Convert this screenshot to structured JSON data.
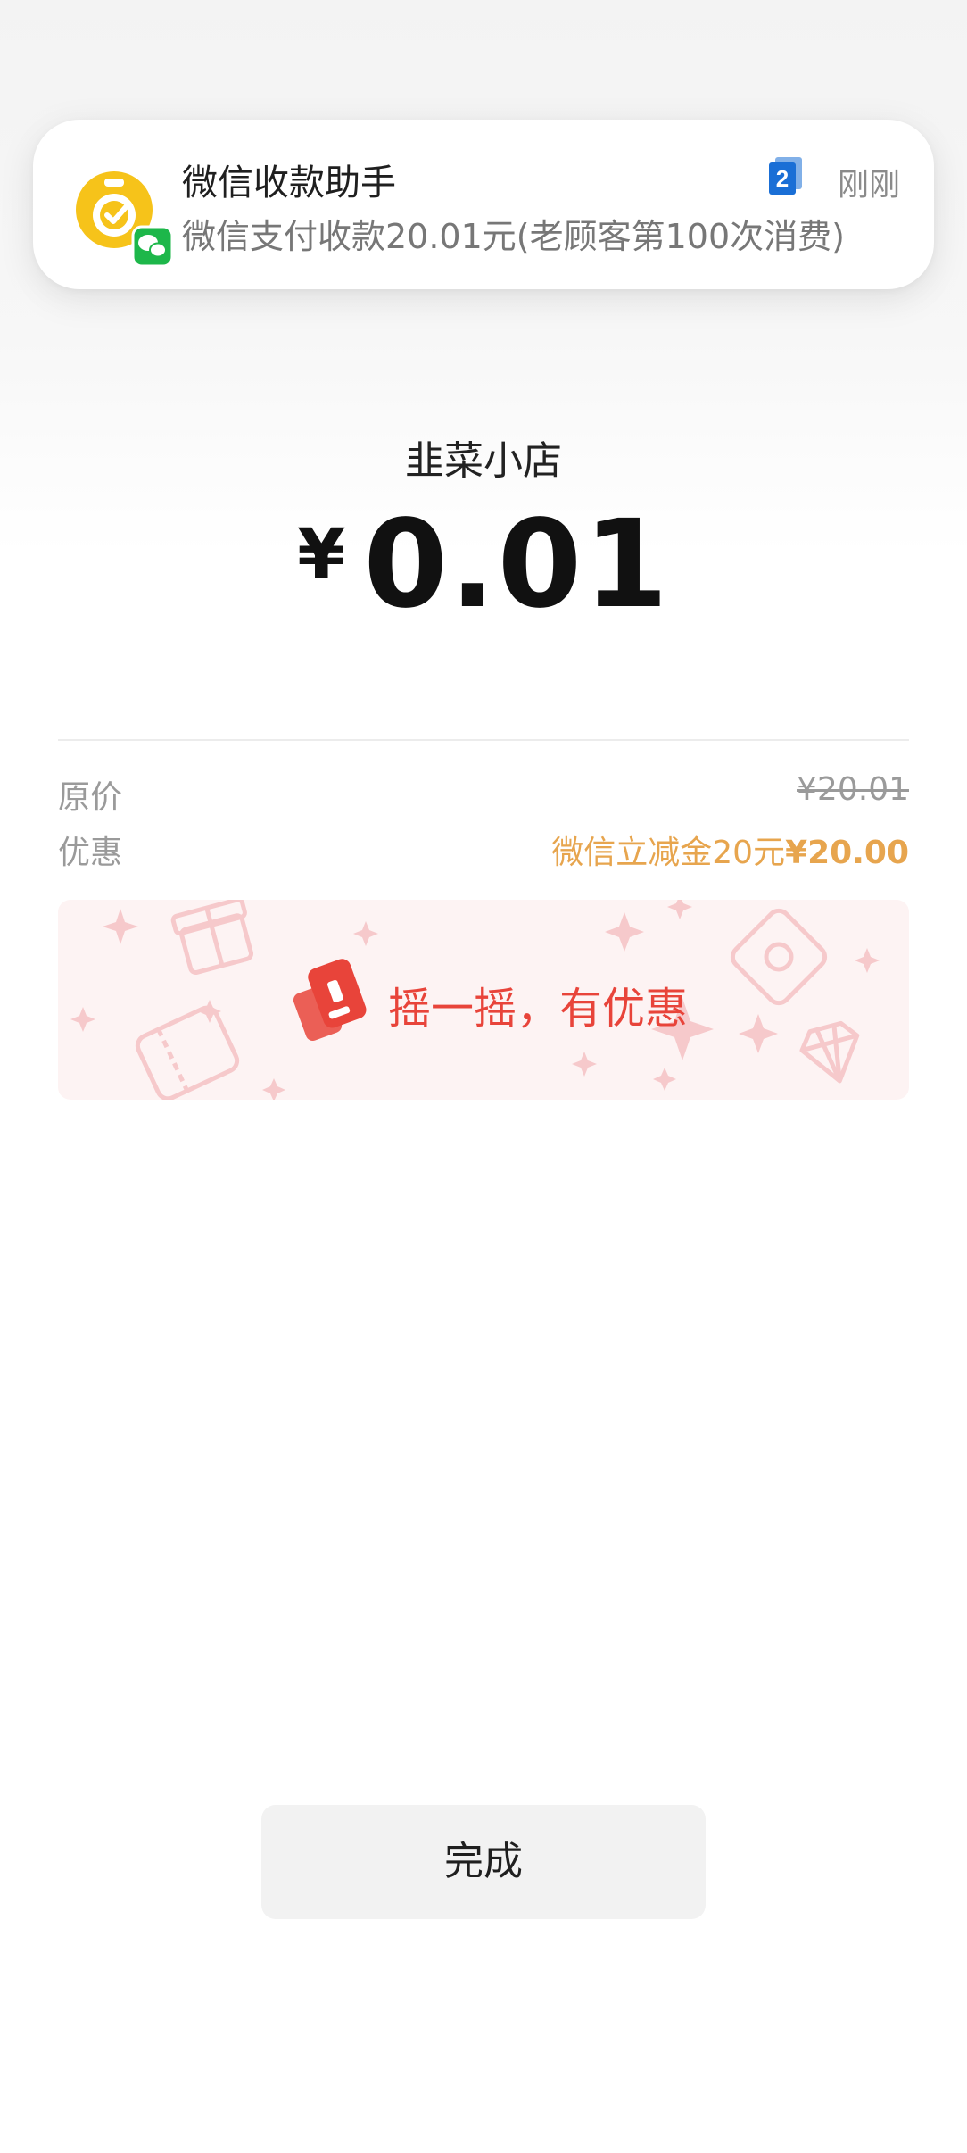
{
  "notification": {
    "title": "微信收款助手",
    "body": "微信支付收款20.01元(老顾客第100次消费)",
    "badge_count": "2",
    "time": "刚刚",
    "icon": "wechat-pay-assistant-icon",
    "accent_color": "#f6c31a"
  },
  "payment": {
    "merchant": "韭菜小店",
    "currency_symbol": "¥",
    "amount": "0.01"
  },
  "details": {
    "original_label": "原价",
    "original_value": "¥20.01",
    "discount_label": "优惠",
    "discount_desc": "微信立减金20元",
    "discount_amount": "¥20.00"
  },
  "shake_banner": {
    "text": "摇一摇，有优惠",
    "icon": "shake-icon",
    "color": "#e8443a"
  },
  "actions": {
    "done_label": "完成"
  }
}
